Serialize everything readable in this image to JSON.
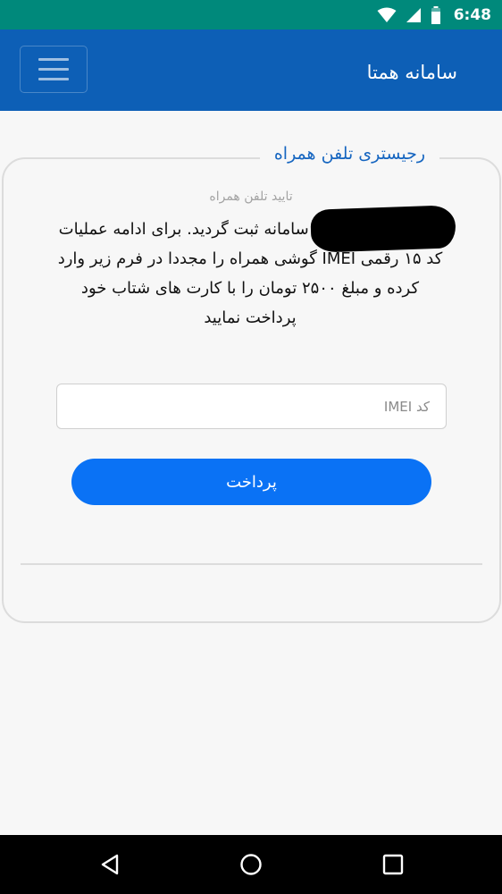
{
  "status_bar": {
    "time": "6:48",
    "icons": [
      "wifi-icon",
      "signal-icon",
      "battery-icon"
    ]
  },
  "app_bar": {
    "title": "سامانه همتا",
    "menu_icon": "hamburger-menu-icon"
  },
  "form": {
    "legend": "رجیستری تلفن همراه",
    "subtitle": "تایید تلفن همراه",
    "message": "تلفن همراه شما در سامانه ثبت گردید. برای ادامه عملیات کد ۱۵ رقمی IMEI گوشی همراه را مجددا در فرم زیر وارد کرده و مبلغ ۲۵۰۰ تومان را با کارت های شتاب خود پرداخت نمایید",
    "imei_placeholder": "کد IMEI",
    "imei_value": "",
    "pay_label": "پرداخت"
  },
  "nav_bar": {
    "icons": [
      "back-icon",
      "home-icon",
      "recents-icon"
    ]
  },
  "colors": {
    "status_bar": "#00897b",
    "app_bar": "#0d5fb6",
    "legend_text": "#1565c0",
    "button": "#0a72f5",
    "background": "#f7f7f7"
  }
}
